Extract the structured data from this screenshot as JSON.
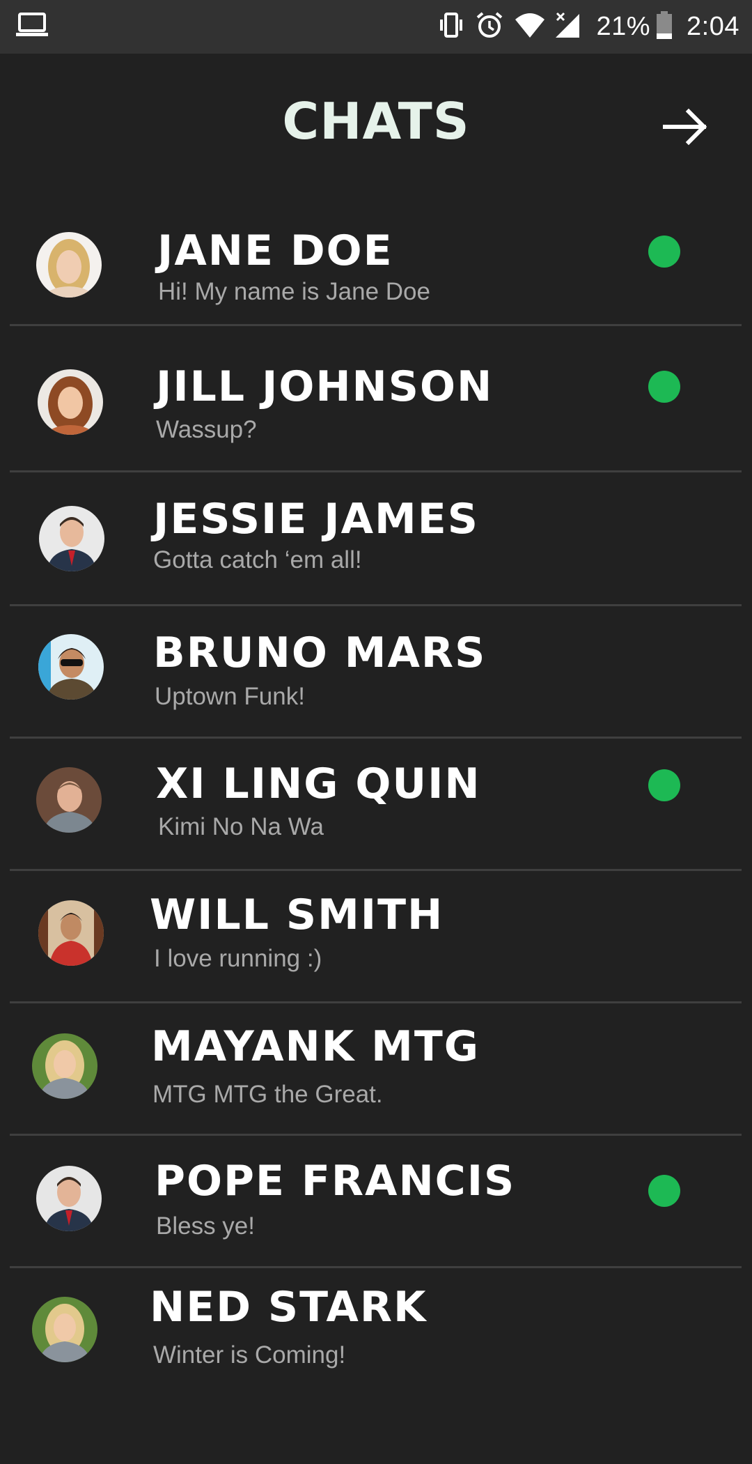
{
  "status_bar": {
    "battery_text": "21%",
    "time": "2:04",
    "icons": [
      "laptop-icon",
      "vibrate-icon",
      "alarm-icon",
      "wifi-icon",
      "signal-icon",
      "battery-icon"
    ]
  },
  "header": {
    "title": "CHATS",
    "action_icon": "arrow-right-icon"
  },
  "colors": {
    "background": "#212121",
    "status_bar": "#323232",
    "title": "#e6f2ea",
    "preview_text": "#a9a9a9",
    "divider": "#3f3f3f",
    "online": "#1db954"
  },
  "chats": [
    {
      "name": "JANE DOE",
      "preview": "Hi! My name is Jane Doe",
      "online": true
    },
    {
      "name": "JILL JOHNSON",
      "preview": "Wassup?",
      "online": true
    },
    {
      "name": "JESSIE JAMES",
      "preview": "Gotta catch ‘em all!",
      "online": false
    },
    {
      "name": "BRUNO MARS",
      "preview": "Uptown Funk!",
      "online": false
    },
    {
      "name": "XI LING QUIN",
      "preview": "Kimi No Na Wa",
      "online": true
    },
    {
      "name": "WILL SMITH",
      "preview": "I love running :)",
      "online": false
    },
    {
      "name": "MAYANK MTG",
      "preview": "MTG MTG the Great.",
      "online": false
    },
    {
      "name": "POPE FRANCIS",
      "preview": "Bless ye!",
      "online": true
    },
    {
      "name": "NED STARK",
      "preview": "Winter is Coming!",
      "online": false
    }
  ]
}
